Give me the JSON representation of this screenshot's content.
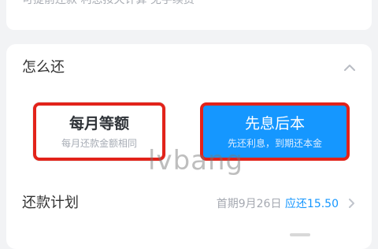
{
  "top_note": "可提前还款 利息按天计算 免手续费",
  "section": {
    "title": "怎么还"
  },
  "options": [
    {
      "title": "每月等额",
      "desc": "每月还款金额相同"
    },
    {
      "title": "先息后本",
      "desc": "先还利息，到期还本金"
    }
  ],
  "watermark": "lvbang",
  "plan": {
    "title": "还款计划",
    "detail_prefix": "首期9月26日 ",
    "detail_accent": "应还15.50"
  },
  "icons": {
    "collapse": "chevron-up-icon",
    "plan": "chevron-right-icon"
  },
  "colors": {
    "accent": "#1597ff",
    "highlight": "#e2231a"
  }
}
